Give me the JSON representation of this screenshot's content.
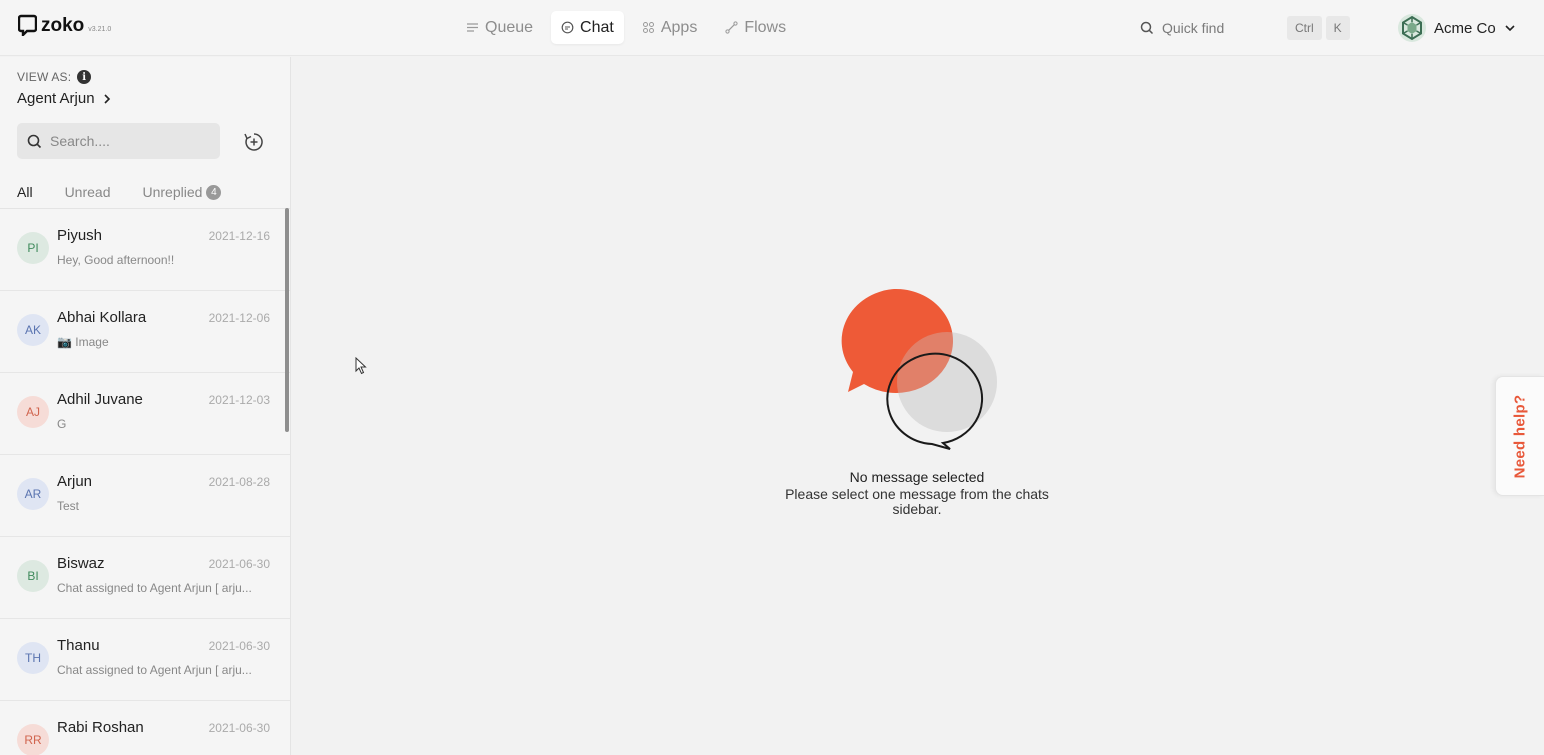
{
  "brand": {
    "name": "zoko",
    "version": "v3.21.0",
    "accent": "#e8583a"
  },
  "nav": {
    "tabs": [
      {
        "label": "Queue",
        "icon": "queue-icon"
      },
      {
        "label": "Chat",
        "icon": "chat-icon",
        "active": true
      },
      {
        "label": "Apps",
        "icon": "apps-icon"
      },
      {
        "label": "Flows",
        "icon": "flows-icon"
      }
    ]
  },
  "quick_find": {
    "label": "Quick find",
    "shortcut": [
      "Ctrl",
      "K"
    ]
  },
  "account": {
    "name": "Acme Co"
  },
  "sidebar": {
    "view_as_label": "VIEW AS:",
    "info_glyph": "i",
    "agent": "Agent Arjun",
    "search_placeholder": "Search....",
    "tabs": [
      {
        "label": "All",
        "active": true
      },
      {
        "label": "Unread"
      },
      {
        "label": "Unreplied",
        "badge": "4"
      }
    ],
    "chats": [
      {
        "initials": "PI",
        "name": "Piyush",
        "date": "2021-12-16",
        "preview": "Hey, Good afternoon!!",
        "avatar_bg": "#dde9e1",
        "avatar_fg": "#3f8a5c"
      },
      {
        "initials": "AK",
        "name": "Abhai Kollara",
        "date": "2021-12-06",
        "preview": "📷 Image",
        "avatar_bg": "#dfe5f3",
        "avatar_fg": "#5a74b0"
      },
      {
        "initials": "AJ",
        "name": "Adhil Juvane",
        "date": "2021-12-03",
        "preview": "G",
        "avatar_bg": "#f6dcd7",
        "avatar_fg": "#d0644e"
      },
      {
        "initials": "AR",
        "name": "Arjun",
        "date": "2021-08-28",
        "preview": "Test",
        "avatar_bg": "#dfe5f3",
        "avatar_fg": "#5a74b0"
      },
      {
        "initials": "BI",
        "name": "Biswaz",
        "date": "2021-06-30",
        "preview": "Chat assigned to Agent Arjun [ arju...",
        "avatar_bg": "#dde9e1",
        "avatar_fg": "#3f8a5c"
      },
      {
        "initials": "TH",
        "name": "Thanu",
        "date": "2021-06-30",
        "preview": "Chat assigned to Agent Arjun [ arju...",
        "avatar_bg": "#dfe5f3",
        "avatar_fg": "#5a74b0"
      },
      {
        "initials": "RR",
        "name": "Rabi Roshan",
        "date": "2021-06-30",
        "preview": "",
        "avatar_bg": "#f6dcd7",
        "avatar_fg": "#d0644e"
      }
    ]
  },
  "main": {
    "empty_title": "No message selected",
    "empty_subtitle": "Please select one message from the chats sidebar."
  },
  "help": {
    "label": "Need help?"
  }
}
